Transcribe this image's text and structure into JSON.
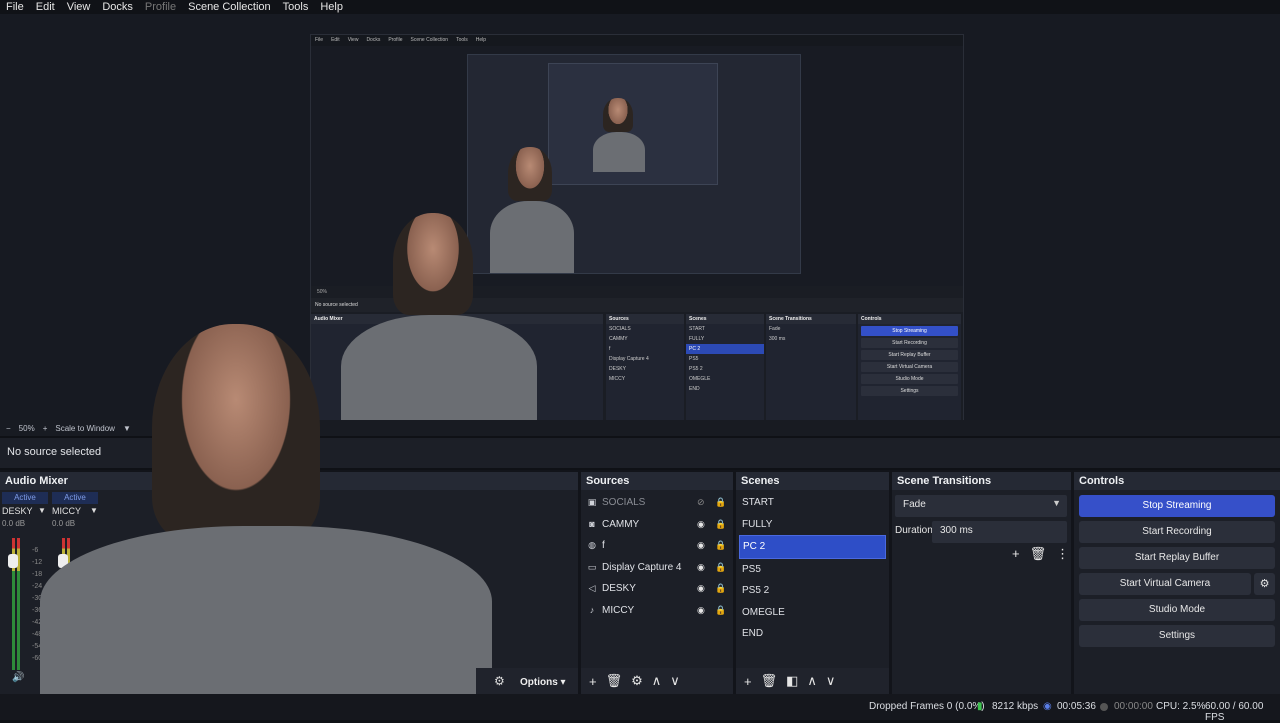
{
  "menu": {
    "items": [
      "File",
      "Edit",
      "View",
      "Docks",
      "Profile",
      "Scene Collection",
      "Tools",
      "Help"
    ]
  },
  "view_strip": {
    "zoom": "50%",
    "scale_mode": "Scale to Window"
  },
  "selection": {
    "text": "No source selected"
  },
  "audio_mixer": {
    "title": "Audio Mixer",
    "channels": [
      {
        "status": "Active",
        "name": "DESKY",
        "db": "0.0 dB"
      },
      {
        "status": "Active",
        "name": "MICCY",
        "db": "0.0 dB"
      }
    ],
    "scale": [
      "-6",
      "-12",
      "-18",
      "-24",
      "-30",
      "-36",
      "-42",
      "-48",
      "-54",
      "-60"
    ]
  },
  "sources": {
    "title": "Sources",
    "items": [
      {
        "icon": "image-icon",
        "name": "SOCIALS",
        "hidden": true
      },
      {
        "icon": "camera-icon",
        "name": "CAMMY",
        "hidden": false
      },
      {
        "icon": "globe-icon",
        "name": "f",
        "hidden": false
      },
      {
        "icon": "monitor-icon",
        "name": "Display Capture 4",
        "hidden": false
      },
      {
        "icon": "speaker-icon",
        "name": "DESKY",
        "hidden": false
      },
      {
        "icon": "microphone-icon",
        "name": "MICCY",
        "hidden": false
      }
    ],
    "options_label": "Options"
  },
  "scenes": {
    "title": "Scenes",
    "items": [
      "START",
      "FULLY",
      "PC 2",
      "PS5",
      "PS5 2",
      "OMEGLE",
      "END"
    ],
    "selected": "PC 2"
  },
  "scene_transitions": {
    "title": "Scene Transitions",
    "transition": "Fade",
    "duration_label": "Duration",
    "duration_value": "300 ms"
  },
  "controls": {
    "title": "Controls",
    "stop_streaming": "Stop Streaming",
    "start_recording": "Start Recording",
    "start_replay_buffer": "Start Replay Buffer",
    "start_virtual_camera": "Start Virtual Camera",
    "studio_mode": "Studio Mode",
    "settings": "Settings"
  },
  "status": {
    "dropped_frames": "Dropped Frames 0 (0.0%)",
    "bitrate": "8212 kbps",
    "stream_time": "00:05:36",
    "record_time": "00:00:00",
    "cpu": "CPU: 2.5%",
    "fps": "60.00 / 60.00 FPS"
  },
  "colors": {
    "accent": "#3650c9",
    "panel": "#1c1f27",
    "background": "#0f1116"
  }
}
